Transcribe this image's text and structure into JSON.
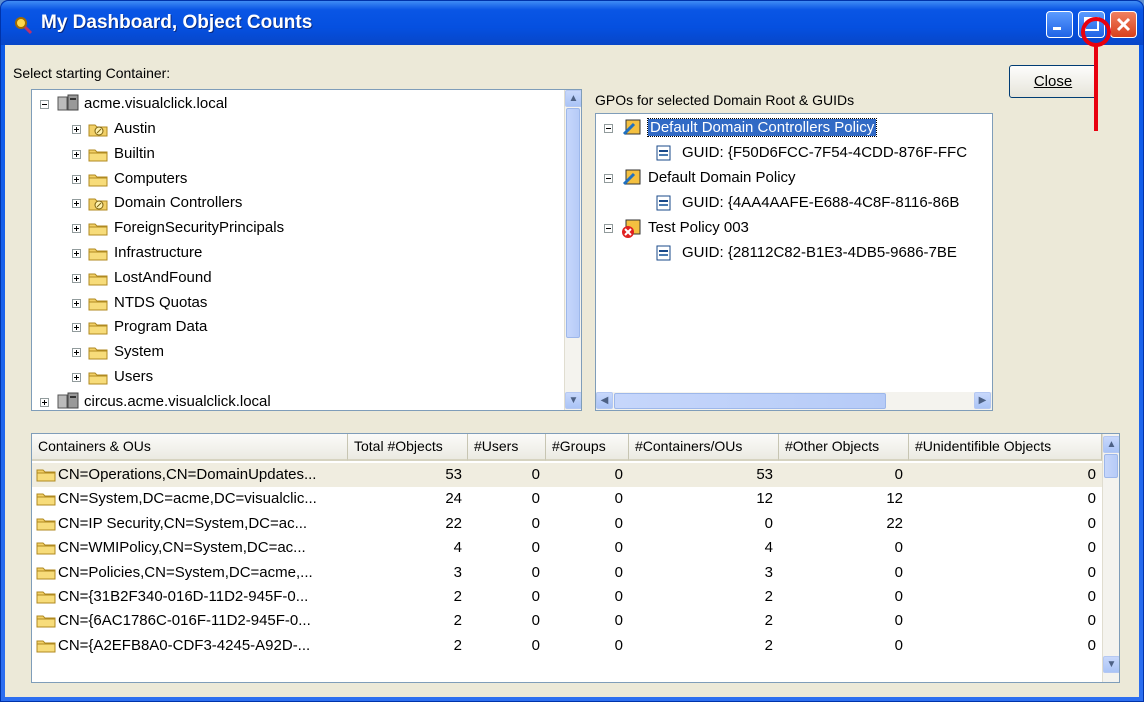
{
  "window": {
    "title": "My Dashboard, Object Counts"
  },
  "labels": {
    "select_container": "Select starting Container:",
    "gpos": "GPOs for selected Domain Root & GUIDs"
  },
  "buttons": {
    "close": "Close"
  },
  "tree": {
    "root": "acme.visualclick.local",
    "children": [
      "Austin",
      "Builtin",
      "Computers",
      "Domain Controllers",
      "ForeignSecurityPrincipals",
      "Infrastructure",
      "LostAndFound",
      "NTDS Quotas",
      "Program Data",
      "System",
      "Users"
    ],
    "root2": "circus.acme.visualclick.local"
  },
  "gpo": [
    {
      "name": "Default Domain Controllers Policy",
      "guid": "GUID: {F50D6FCC-7F54-4CDD-876F-FFC"
    },
    {
      "name": "Default Domain Policy",
      "guid": "GUID: {4AA4AAFE-E688-4C8F-8116-86B"
    },
    {
      "name": "Test Policy 003",
      "guid": "GUID: {28112C82-B1E3-4DB5-9686-7BE"
    }
  ],
  "table": {
    "columns": [
      "Containers & OUs",
      "Total #Objects",
      "#Users",
      "#Groups",
      "#Containers/OUs",
      "#Other Objects",
      "#Unidentifible Objects"
    ],
    "rows": [
      [
        "CN=Operations,CN=DomainUpdates...",
        "53",
        "0",
        "0",
        "53",
        "0",
        "0"
      ],
      [
        "CN=System,DC=acme,DC=visualclic...",
        "24",
        "0",
        "0",
        "12",
        "12",
        "0"
      ],
      [
        "CN=IP Security,CN=System,DC=ac...",
        "22",
        "0",
        "0",
        "0",
        "22",
        "0"
      ],
      [
        "CN=WMIPolicy,CN=System,DC=ac...",
        "4",
        "0",
        "0",
        "4",
        "0",
        "0"
      ],
      [
        "CN=Policies,CN=System,DC=acme,...",
        "3",
        "0",
        "0",
        "3",
        "0",
        "0"
      ],
      [
        "CN={31B2F340-016D-11D2-945F-0...",
        "2",
        "0",
        "0",
        "2",
        "0",
        "0"
      ],
      [
        "CN={6AC1786C-016F-11D2-945F-0...",
        "2",
        "0",
        "0",
        "2",
        "0",
        "0"
      ],
      [
        "CN={A2EFB8A0-CDF3-4245-A92D-...",
        "2",
        "0",
        "0",
        "2",
        "0",
        "0"
      ]
    ]
  },
  "colors": {
    "title_blue": "#0a56e5",
    "annotation": "#e8000f",
    "selection": "#316ac5"
  }
}
